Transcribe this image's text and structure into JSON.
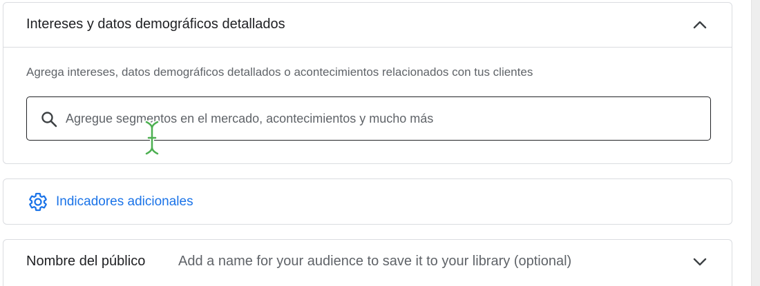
{
  "interests": {
    "title": "Intereses y datos demográficos detallados",
    "collapse_icon": "chevron-up-icon",
    "description": "Agrega intereses, datos demográficos detallados o acontecimientos relacionados con tus clientes",
    "search": {
      "icon": "search-icon",
      "placeholder": "Agregue segmentos en el mercado, acontecimientos y mucho más",
      "value": ""
    }
  },
  "indicators": {
    "icon": "gear-icon",
    "label": "Indicadores adicionales"
  },
  "audience_name": {
    "label": "Nombre del público",
    "hint": "Add a name for your audience to save it to your library (optional)",
    "expand_icon": "chevron-down-icon"
  },
  "colors": {
    "link": "#1a73e8",
    "border": "#dadce0",
    "text_primary": "#202124",
    "text_secondary": "#5f6368",
    "cursor": "#4caf50"
  }
}
